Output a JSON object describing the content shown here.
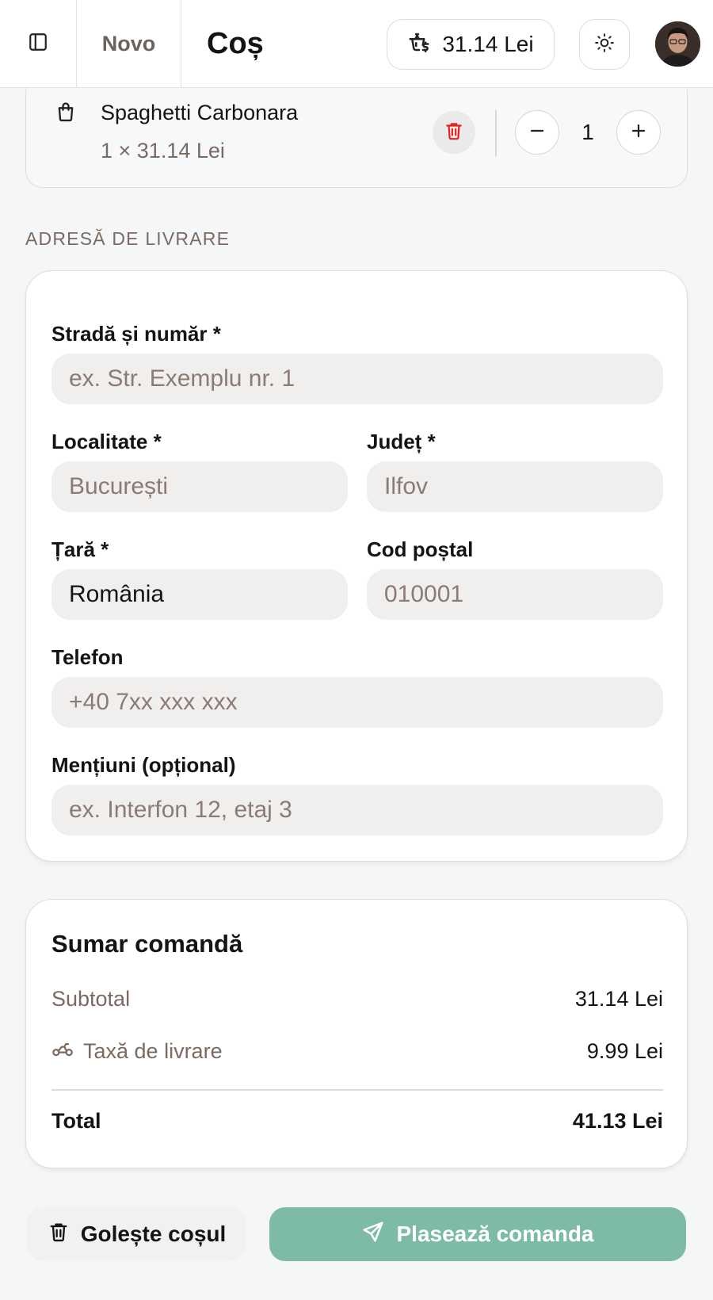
{
  "header": {
    "brand": "Novo",
    "title": "Coș",
    "cart_total": "31.14 Lei",
    "icons": {
      "sidebar": "sidebar-toggle-icon",
      "cart": "basket-money-icon",
      "theme": "sun-icon",
      "avatar": "user-avatar"
    }
  },
  "cart": {
    "items": [
      {
        "name": "Spaghetti Carbonara",
        "qty_price": "1 × 31.14 Lei",
        "quantity": "1"
      }
    ]
  },
  "address": {
    "section_label": "ADRESĂ DE LIVRARE",
    "street": {
      "label": "Stradă și număr *",
      "placeholder": "ex. Str. Exemplu nr. 1",
      "value": ""
    },
    "city": {
      "label": "Localitate *",
      "placeholder": "București",
      "value": ""
    },
    "county": {
      "label": "Județ *",
      "placeholder": "Ilfov",
      "value": ""
    },
    "country": {
      "label": "Țară *",
      "placeholder": "",
      "value": "România"
    },
    "postal": {
      "label": "Cod poștal",
      "placeholder": "010001",
      "value": ""
    },
    "phone": {
      "label": "Telefon",
      "placeholder": "+40 7xx xxx xxx",
      "value": ""
    },
    "notes": {
      "label": "Mențiuni (opțional)",
      "placeholder": "ex. Interfon 12, etaj 3",
      "value": ""
    }
  },
  "summary": {
    "title": "Sumar comandă",
    "subtotal_label": "Subtotal",
    "subtotal_value": "31.14 Lei",
    "delivery_label": "Taxă de livrare",
    "delivery_value": "9.99 Lei",
    "total_label": "Total",
    "total_value": "41.13 Lei"
  },
  "actions": {
    "clear_label": "Golește coșul",
    "place_label": "Plasează comanda"
  },
  "colors": {
    "accent": "#7dbaa8",
    "danger": "#e0201c",
    "muted_text": "#7a6a62",
    "input_bg": "#f1efee"
  }
}
